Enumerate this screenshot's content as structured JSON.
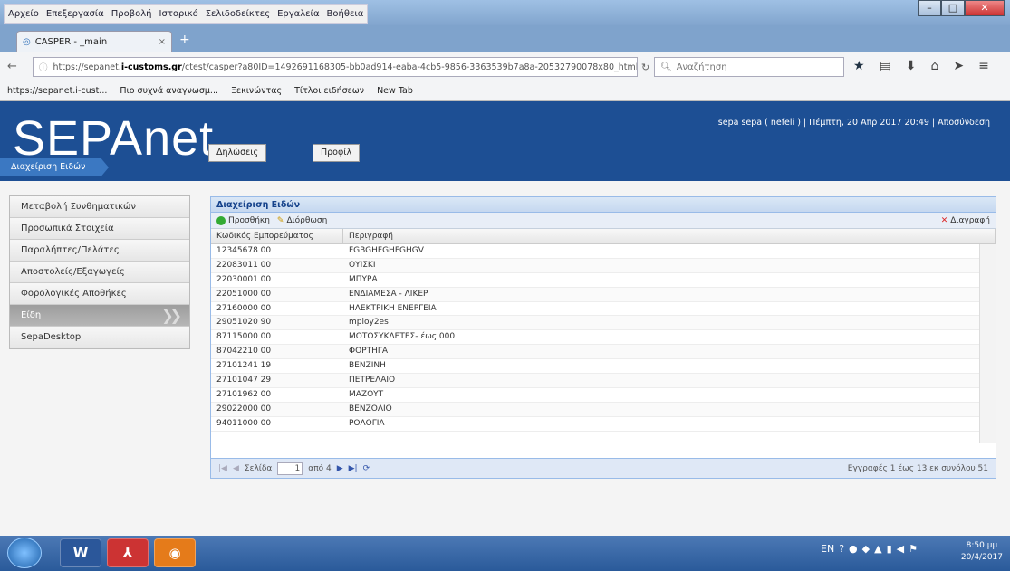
{
  "browser": {
    "menu": [
      "Αρχείο",
      "Επεξεργασία",
      "Προβολή",
      "Ιστορικό",
      "Σελιδοδείκτες",
      "Εργαλεία",
      "Βοήθεια"
    ],
    "tab_title": "CASPER - _main",
    "url_prefix": "https://sepanet.",
    "url_domain": "i-customs.gr",
    "url_rest": "/ctest/casper?a80ID=1492691168305-bb0ad914-eaba-4cb5-9856-3363539b7a8a-20532790078x80_html_pag",
    "search_placeholder": "Αναζήτηση",
    "bookmarks": [
      "https://sepanet.i-cust...",
      "Πιο συχνά αναγνωσμ...",
      "Ξεκινώντας",
      "Τίτλοι ειδήσεων",
      "New Tab"
    ]
  },
  "header": {
    "logo": "SEPAnet",
    "btn_declarations": "Δηλώσεις",
    "btn_profile": "Προφίλ",
    "user_info": "sepa sepa ( nefeli ) | Πέμπτη, 20 Απρ 2017 20:49 | Αποσύνδεση",
    "breadcrumb": "Διαχείριση Ειδών"
  },
  "sidebar": {
    "items": [
      {
        "label": "Μεταβολή Συνθηματικών"
      },
      {
        "label": "Προσωπικά Στοιχεία"
      },
      {
        "label": "Παραλήπτες/Πελάτες"
      },
      {
        "label": "Αποστολείς/Εξαγωγείς"
      },
      {
        "label": "Φορολογικές Αποθήκες"
      },
      {
        "label": "Είδη"
      },
      {
        "label": "SepaDesktop"
      }
    ]
  },
  "grid": {
    "title": "Διαχείριση Ειδών",
    "add_label": "Προσθήκη",
    "edit_label": "Διόρθωση",
    "delete_label": "Διαγραφή",
    "col_code": "Κωδικός Εμπορεύματος",
    "col_desc": "Περιγραφή",
    "rows": [
      {
        "code": "12345678 00",
        "desc": "FGBGHFGHFGHGV"
      },
      {
        "code": "22083011 00",
        "desc": "ΟΥΙΣΚΙ"
      },
      {
        "code": "22030001 00",
        "desc": "ΜΠΥΡΑ"
      },
      {
        "code": "22051000 00",
        "desc": "ΕΝΔΙΑΜΕΣΑ - ΛΙΚΕΡ"
      },
      {
        "code": "27160000 00",
        "desc": "ΗΛΕΚΤΡΙΚΗ ΕΝΕΡΓΕΙΑ"
      },
      {
        "code": "29051020 90",
        "desc": "mploy2es"
      },
      {
        "code": "87115000 00",
        "desc": "ΜΟΤΟΣΥΚΛΕΤΕΣ- έως 000"
      },
      {
        "code": "87042210 00",
        "desc": "ΦΟΡΤΗΓΑ"
      },
      {
        "code": "27101241 19",
        "desc": "ΒΕΝΖΙΝΗ"
      },
      {
        "code": "27101047 29",
        "desc": "ΠΕΤΡΕΛΑΙΟ"
      },
      {
        "code": "27101962 00",
        "desc": "ΜΑΖΟΥΤ"
      },
      {
        "code": "29022000 00",
        "desc": "ΒΕΝΖΟΛΙΟ"
      },
      {
        "code": "94011000 00",
        "desc": "ΡΟΛΟΓΙΑ"
      }
    ],
    "pager_page_label": "Σελίδα",
    "pager_page_value": "1",
    "pager_of": "από 4",
    "pager_info": "Εγγραφές 1 έως 13 εκ συνόλου 51"
  },
  "taskbar": {
    "lang": "EN",
    "time": "8:50 μμ",
    "date": "20/4/2017"
  }
}
